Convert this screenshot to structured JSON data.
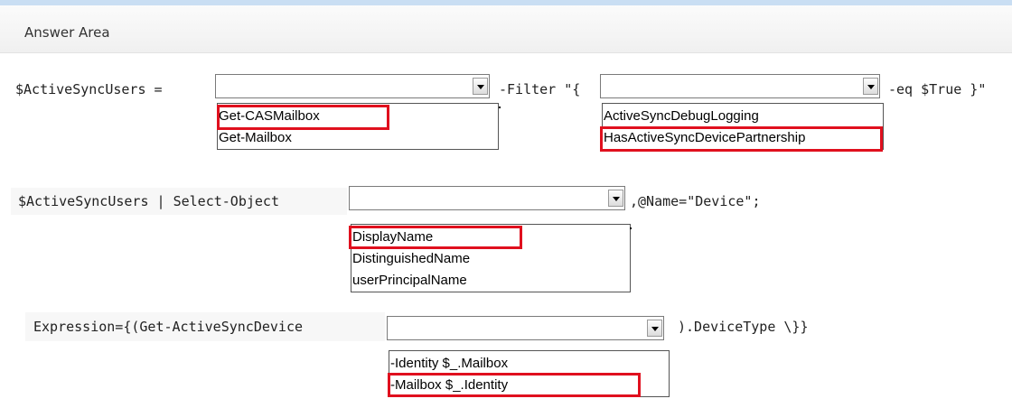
{
  "header": {
    "title": "Answer Area"
  },
  "row1": {
    "prefix": "$ActiveSyncUsers =",
    "filter_text": "-Filter \"{",
    "suffix": "-eq $True }\"",
    "dropdown1_selected": "",
    "dropdown1_options": [
      "Get-CASMailbox",
      "Get-Mailbox"
    ],
    "dropdown2_selected": "",
    "dropdown2_options": [
      "ActiveSyncDebugLogging",
      "HasActiveSyncDevicePartnership"
    ]
  },
  "row2": {
    "prefix": "$ActiveSyncUsers | Select-Object",
    "suffix": ",@Name=\"Device\";",
    "dropdown_selected": "",
    "dropdown_options": [
      "DisplayName",
      "DistinguishedName",
      "userPrincipalName"
    ]
  },
  "row3": {
    "prefix": "Expression={(Get-ActiveSyncDevice",
    "suffix": ").DeviceType \\}}",
    "dropdown_selected": "",
    "dropdown_options": [
      "-Identity $_.Mailbox",
      "-Mailbox $_.Identity"
    ]
  },
  "colors": {
    "highlight": "#e0101e",
    "header_band": "#c9def3"
  }
}
